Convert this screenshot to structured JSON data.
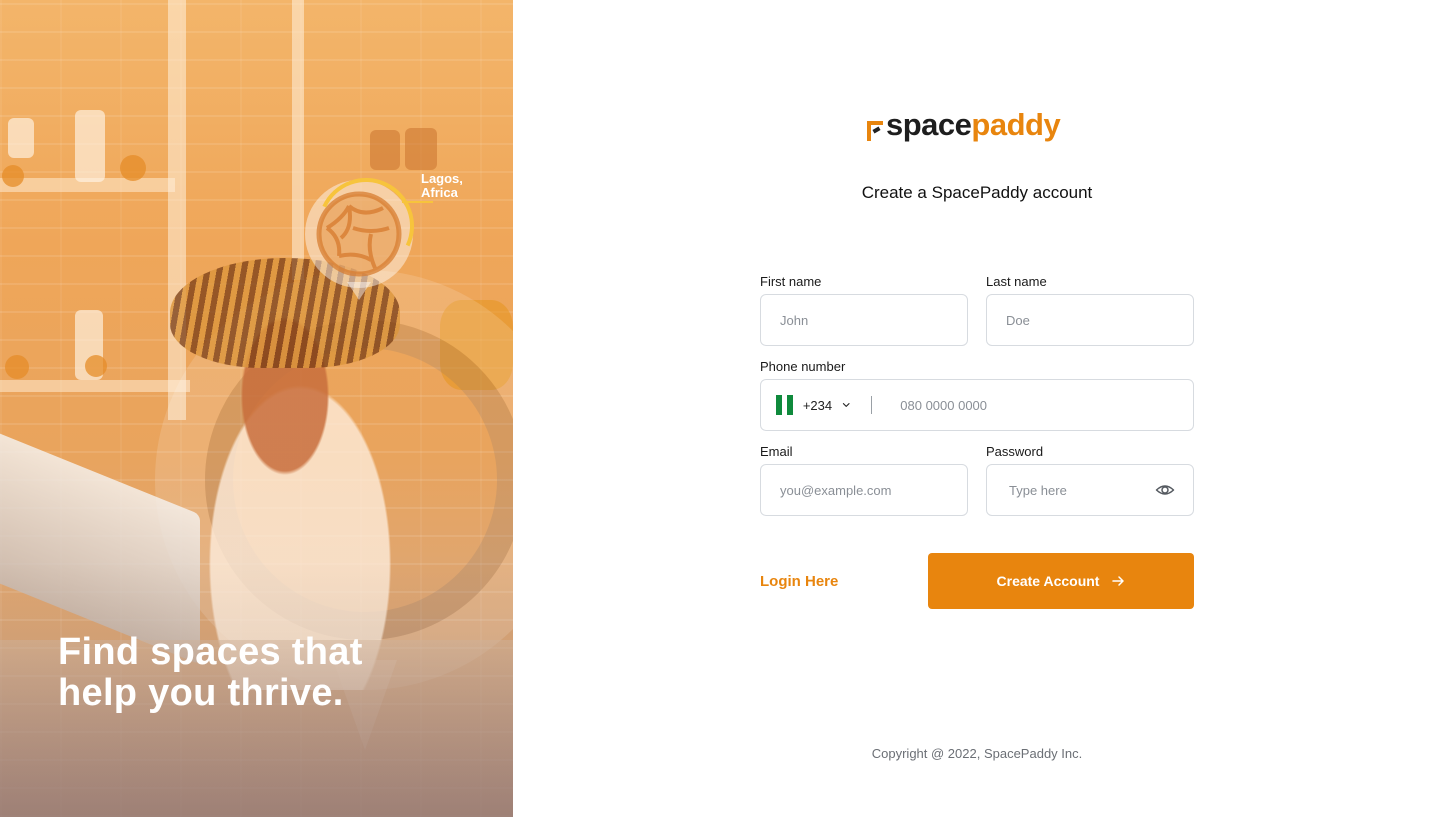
{
  "hero": {
    "location_label": "Lagos,\nAfrica",
    "location_line1": "Lagos,",
    "location_line2": "Africa",
    "headline_line1": "Find spaces that",
    "headline_line2": "help you thrive."
  },
  "brand": {
    "name_part1": "space",
    "name_part2": "paddy",
    "accent_color": "#e8850e"
  },
  "form": {
    "title": "Create a SpacePaddy account",
    "first_name": {
      "label": "First name",
      "placeholder": "John",
      "value": ""
    },
    "last_name": {
      "label": "Last name",
      "placeholder": "Doe",
      "value": ""
    },
    "phone": {
      "label": "Phone number",
      "country_code": "+234",
      "country_flag": "nigeria-flag",
      "placeholder": "080 0000 0000",
      "value": ""
    },
    "email": {
      "label": "Email",
      "placeholder": "you@example.com",
      "value": ""
    },
    "password": {
      "label": "Password",
      "placeholder": "Type here",
      "value": ""
    },
    "login_link": "Login Here",
    "submit_label": "Create Account"
  },
  "footer": {
    "copyright": "Copyright @ 2022, SpacePaddy Inc."
  },
  "icons": {
    "globe": "globe-icon",
    "chevron": "chevron-down-icon",
    "eye": "eye-icon",
    "arrow": "arrow-right-icon"
  }
}
